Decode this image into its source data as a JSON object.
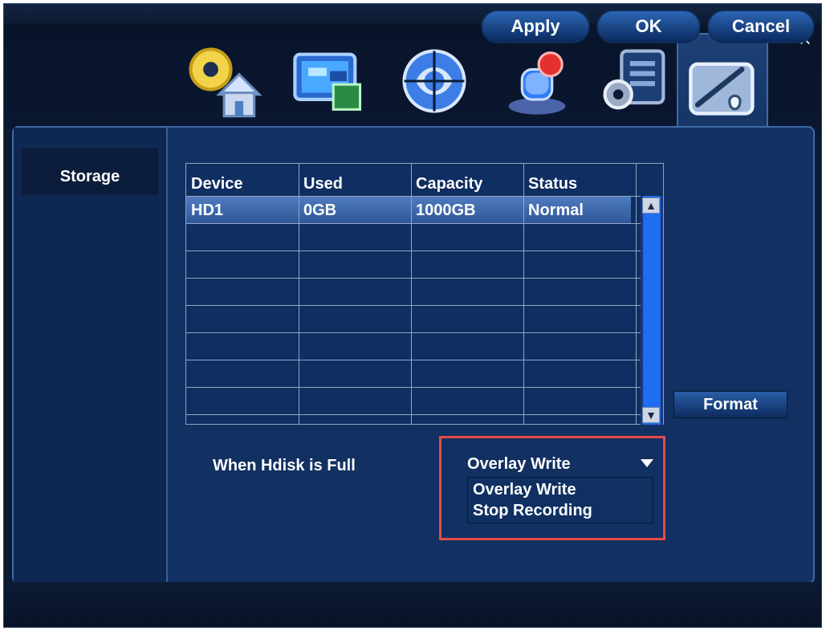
{
  "window": {
    "close_icon": "×",
    "tabs": [
      {
        "icon": "general-settings-icon"
      },
      {
        "icon": "display-icon"
      },
      {
        "icon": "network-icon"
      },
      {
        "icon": "alarm-icon"
      },
      {
        "icon": "system-icon"
      },
      {
        "icon": "advanced-icon",
        "active": true
      }
    ]
  },
  "sidebar": {
    "items": [
      {
        "label": "Storage"
      }
    ]
  },
  "storage_table": {
    "columns": [
      "Device",
      "Used",
      "Capacity",
      "Status"
    ],
    "rows": [
      {
        "device": "HD1",
        "used": "0GB",
        "capacity": "1000GB",
        "status": "Normal"
      }
    ]
  },
  "buttons": {
    "format": "Format",
    "apply": "Apply",
    "ok": "OK",
    "cancel": "Cancel"
  },
  "hdisk_full": {
    "label": "When Hdisk is Full",
    "selected": "Overlay Write",
    "options": [
      "Overlay Write",
      "Stop Recording"
    ]
  },
  "colors": {
    "background": "#0b1a33",
    "panel": "#123061",
    "accent": "#1f6df0",
    "highlight": "#e44b4a"
  }
}
